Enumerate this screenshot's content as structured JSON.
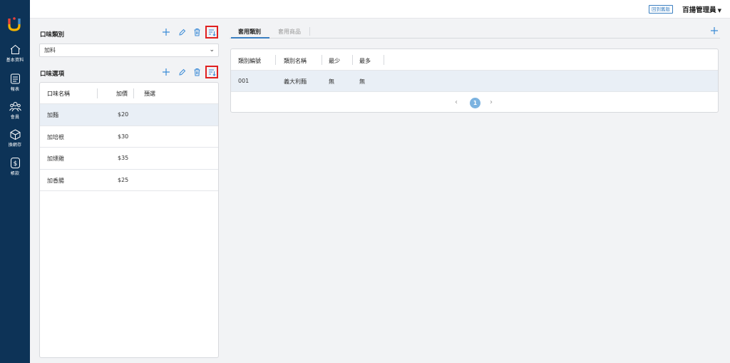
{
  "sidebar": {
    "items": [
      {
        "label": "基本資料",
        "icon": "home-icon"
      },
      {
        "label": "報表",
        "icon": "report-icon"
      },
      {
        "label": "會員",
        "icon": "members-icon"
      },
      {
        "label": "換網存",
        "icon": "box-icon"
      },
      {
        "label": "帳款",
        "icon": "dollar-icon"
      }
    ],
    "brand_colors": [
      "#e8403a",
      "#f4b400",
      "#3a8ad6"
    ]
  },
  "topbar": {
    "back_label": "回到舊版",
    "user_name": "百揚管理員"
  },
  "flavor_category": {
    "title": "口味類別",
    "selected": "加料"
  },
  "flavor_options": {
    "title": "口味選項",
    "columns": [
      "口味名稱",
      "加價",
      "預選"
    ],
    "rows": [
      {
        "name": "加麵",
        "price": "$20"
      },
      {
        "name": "加培根",
        "price": "$30"
      },
      {
        "name": "加燻雞",
        "price": "$35"
      },
      {
        "name": "加香腸",
        "price": "$25"
      }
    ]
  },
  "apply": {
    "tabs": [
      "套用類別",
      "套用商品"
    ],
    "columns": [
      "類別編號",
      "類別名稱",
      "最少",
      "最多"
    ],
    "rows": [
      {
        "id": "001",
        "name": "義大利麵",
        "min": "無",
        "max": "無"
      }
    ],
    "page": "1"
  },
  "colors": {
    "accent": "#3a8ad6",
    "sidebar": "#0d3357",
    "highlight_border": "#e02020"
  }
}
